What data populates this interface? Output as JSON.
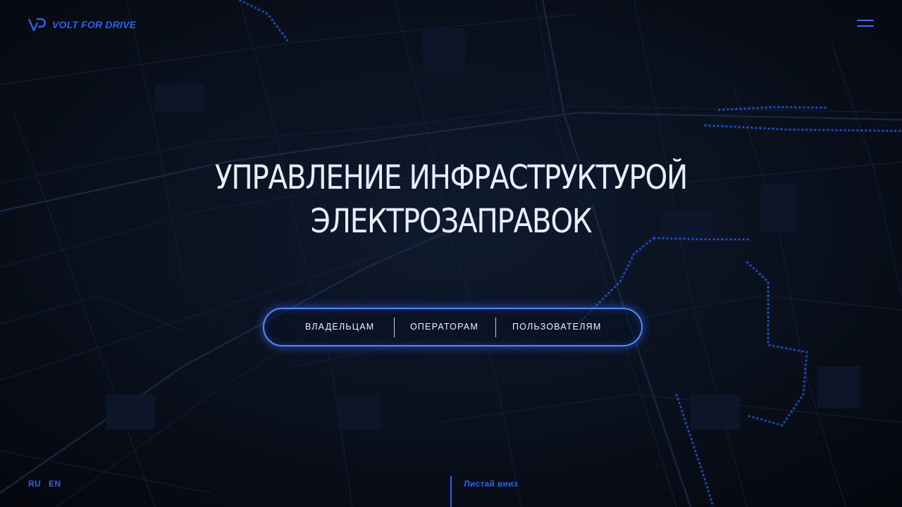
{
  "brand": {
    "name": "VOLT FOR DRIVE",
    "color": "#2f62e8"
  },
  "hero": {
    "title_line1": "УПРАВЛЕНИЕ ИНФРАСТРУКТУРОЙ",
    "title_line2": "ЭЛЕКТРОЗАПРАВОК"
  },
  "nav": {
    "items": [
      {
        "label": "ВЛАДЕЛЬЦАМ"
      },
      {
        "label": "ОПЕРАТОРАМ"
      },
      {
        "label": "ПОЛЬЗОВАТЕЛЯМ"
      }
    ]
  },
  "footer": {
    "languages": [
      "RU",
      "EN"
    ],
    "active_language": "RU",
    "scroll_hint": "Листай вниз"
  },
  "icons": {
    "logo": "vd-logo-icon",
    "menu": "hamburger-menu-icon"
  }
}
